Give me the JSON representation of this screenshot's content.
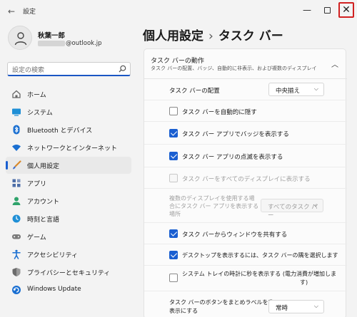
{
  "app": {
    "title": "設定"
  },
  "profile": {
    "name": "秋葉一郎",
    "email_suffix": "@outlook.jp"
  },
  "search": {
    "placeholder": "設定の検索"
  },
  "nav": [
    {
      "label": "ホーム",
      "icon": "home-icon",
      "color": "#6b6b6b"
    },
    {
      "label": "システム",
      "icon": "system-icon",
      "color": "#1f8fd6"
    },
    {
      "label": "Bluetooth とデバイス",
      "icon": "bluetooth-icon",
      "color": "#1a6fd1"
    },
    {
      "label": "ネットワークとインターネット",
      "icon": "wifi-icon",
      "color": "#1a6fd1"
    },
    {
      "label": "個人用設定",
      "icon": "brush-icon",
      "color": "#d98a2b",
      "active": true
    },
    {
      "label": "アプリ",
      "icon": "apps-icon",
      "color": "#4d6ea8"
    },
    {
      "label": "アカウント",
      "icon": "account-icon",
      "color": "#2fa36b"
    },
    {
      "label": "時刻と言語",
      "icon": "time-language-icon",
      "color": "#1f8fd6"
    },
    {
      "label": "ゲーム",
      "icon": "gamepad-icon",
      "color": "#7a7a7a"
    },
    {
      "label": "アクセシビリティ",
      "icon": "accessibility-icon",
      "color": "#1a6fd1"
    },
    {
      "label": "プライバシーとセキュリティ",
      "icon": "shield-icon",
      "color": "#6b6b6b"
    },
    {
      "label": "Windows Update",
      "icon": "update-icon",
      "color": "#1a6fd1"
    }
  ],
  "breadcrumb": {
    "parent": "個人用設定",
    "separator": "›",
    "current": "タスク バー"
  },
  "section": {
    "title": "タスク バーの動作",
    "subtitle": "タスク バーの配置、バッジ、自動的に非表示、および複数のディスプレイ"
  },
  "settings": {
    "alignment": {
      "label": "タスク バーの配置",
      "value": "中央揃え"
    },
    "auto_hide": {
      "label": "タスク バーを自動的に隠す",
      "checked": false
    },
    "badges": {
      "label": "タスク バー アプリでバッジを表示する",
      "checked": true
    },
    "flashing": {
      "label": "タスク バー アプリの点滅を表示する",
      "checked": true
    },
    "all_displays": {
      "label": "タスク バーをすべてのディスプレイに表示する",
      "checked": false,
      "disabled": true
    },
    "multi_display": {
      "label_line1": "複数のディスプレイを使用する場",
      "label_line2": "合にタスク バー アプリを表示する",
      "label_line3": "場所",
      "value": "すべてのタスク バー"
    },
    "share_window": {
      "label": "タスク バーからウィンドウを共有する",
      "checked": true
    },
    "show_desktop": {
      "label": "デスクトップを表示するには、タスク バーの隅を選択します",
      "checked": true
    },
    "seconds_clock": {
      "label": "システム トレイの時計に秒を表示する (電力消費が増加しま",
      "label_line2": "す)",
      "checked": false
    },
    "combine_buttons": {
      "label_line1": "タスク バーのボタンをまとめラベルを非",
      "label_line2": "表示にする",
      "value": "常時"
    }
  },
  "colors": {
    "accent": "#1a5fd1",
    "close_highlight": "#d12121"
  }
}
